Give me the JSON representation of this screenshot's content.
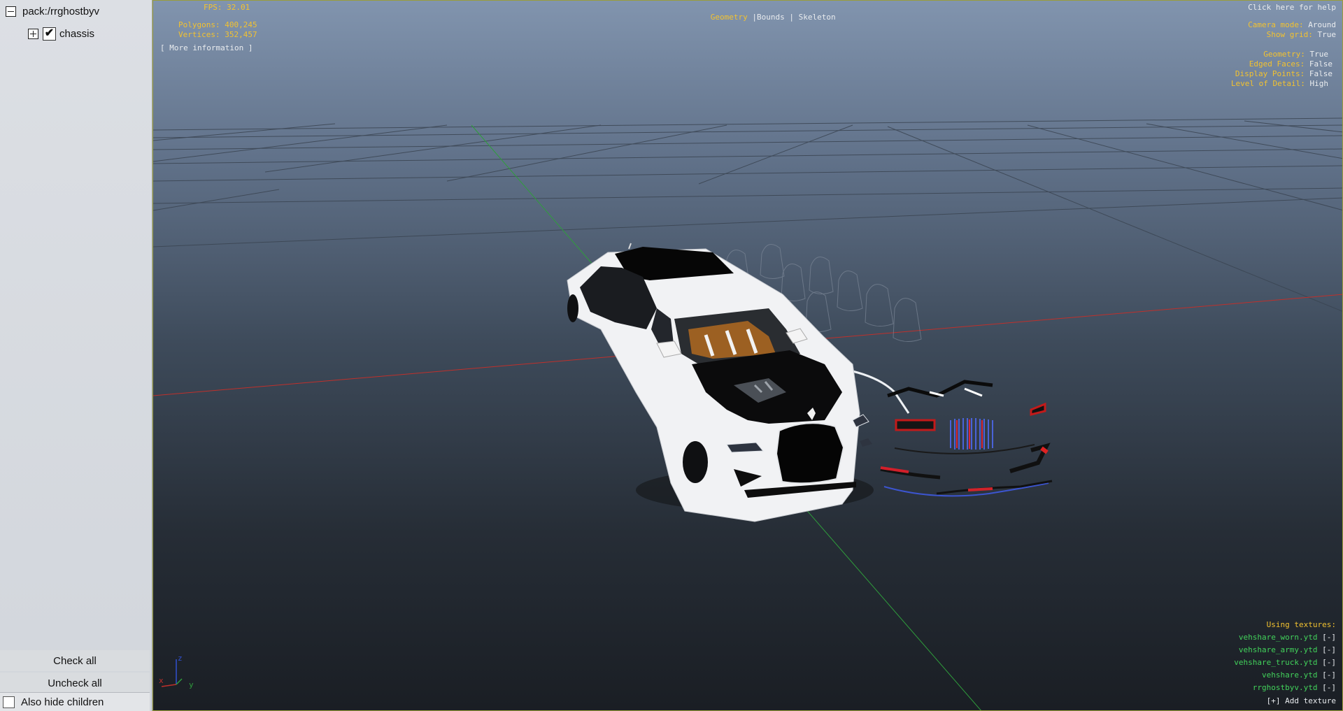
{
  "sidebar": {
    "root_label": "pack:/rrghostbyv",
    "child_label": "chassis",
    "child_checked": "✔",
    "check_all": "Check all",
    "uncheck_all": "Uncheck all",
    "also_hide_children": "Also hide children"
  },
  "hud": {
    "fps": "FPS: 32.01",
    "polygons": "Polygons: 400,245",
    "vertices": "Vertices: 352,457",
    "more_info": "[ More information ]",
    "tabs": {
      "geometry": "Geometry",
      "sep1": "|",
      "bounds": "Bounds",
      "sep2": "|",
      "skeleton": "Skeleton"
    },
    "help": "Click here for help",
    "settings": [
      {
        "key": "Camera mode:",
        "value": "Around"
      },
      {
        "key": "Show grid:",
        "value": "True"
      },
      {
        "key": "Geometry:",
        "value": "True"
      },
      {
        "key": "Edged Faces:",
        "value": "False"
      },
      {
        "key": "Display Points:",
        "value": "False"
      },
      {
        "key": "Level of Detail:",
        "value": "High"
      }
    ],
    "textures_title": "Using textures:",
    "textures": [
      {
        "name": "vehshare_worn.ytd",
        "remove": "[-]"
      },
      {
        "name": "vehshare_army.ytd",
        "remove": "[-]"
      },
      {
        "name": "vehshare_truck.ytd",
        "remove": "[-]"
      },
      {
        "name": "vehshare.ytd",
        "remove": "[-]"
      },
      {
        "name": "rrghostbyv.ytd",
        "remove": "[-]"
      }
    ],
    "add_texture": "[+] Add texture"
  },
  "axes": {
    "x": "x",
    "y": "y",
    "z": "z"
  },
  "colors": {
    "hud_yellow": "#f2c230",
    "hud_green": "#42d25b",
    "axis_red": "#c0302b",
    "axis_green": "#2f9e3c",
    "axis_blue": "#3050d0"
  }
}
